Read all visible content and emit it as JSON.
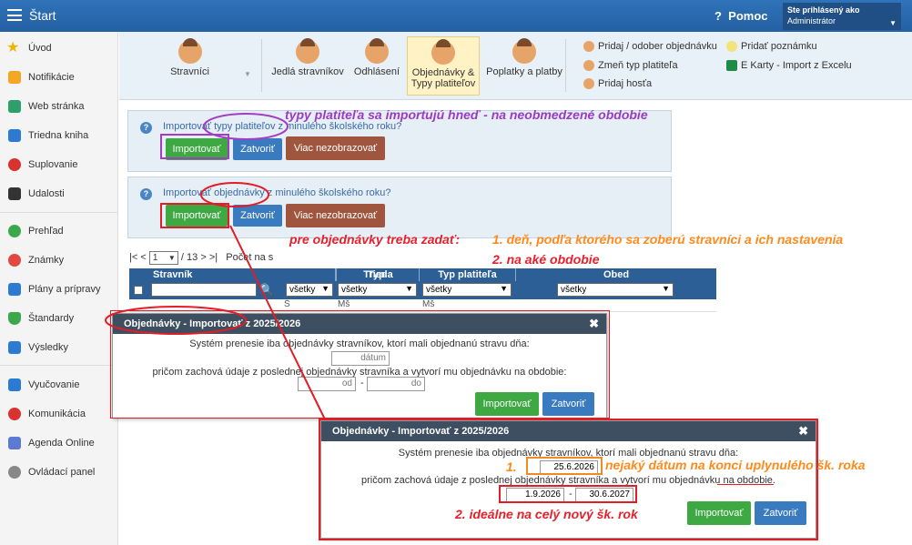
{
  "topbar": {
    "title": "Štart",
    "help_label": "Pomoc",
    "help_icon": "question-icon",
    "user_caption": "Ste prihlásený ako",
    "user_name": "Administrátor"
  },
  "sidebar": {
    "items": [
      {
        "label": "Úvod",
        "icon": "star-icon",
        "color": "#f0b400"
      },
      {
        "label": "Notifikácie",
        "icon": "envelope-icon",
        "color": "#f5a623"
      },
      {
        "label": "Web stránka",
        "icon": "house-icon",
        "color": "#2e9f6b"
      },
      {
        "label": "Triedna kniha",
        "icon": "book-icon",
        "color": "#2a7bd1"
      },
      {
        "label": "Suplovanie",
        "icon": "user-icon",
        "color": "#d9322f"
      },
      {
        "label": "Udalosti",
        "icon": "calendar-icon",
        "color": "#333333"
      },
      {
        "label": "Prehľad",
        "icon": "check-circle-icon",
        "color": "#3ba84a"
      },
      {
        "label": "Známky",
        "icon": "grade-icon",
        "color": "#e4473f"
      },
      {
        "label": "Plány a prípravy",
        "icon": "briefcase-icon",
        "color": "#2a7bd1"
      },
      {
        "label": "Štandardy",
        "icon": "shield-icon",
        "color": "#3ba84a"
      },
      {
        "label": "Výsledky",
        "icon": "bar-chart-icon",
        "color": "#2a7bd1"
      },
      {
        "label": "Vyučovanie",
        "icon": "open-book-icon",
        "color": "#2a7bd1"
      },
      {
        "label": "Komunikácia",
        "icon": "chat-icon",
        "color": "#d9322f"
      },
      {
        "label": "Agenda Online",
        "icon": "feather-icon",
        "color": "#5a7bd1"
      },
      {
        "label": "Ovládací panel",
        "icon": "gear-icon",
        "color": "#888888"
      }
    ]
  },
  "ribbon": {
    "buttons": [
      {
        "label": "Stravníci"
      },
      {
        "label": "Jedlá stravníkov"
      },
      {
        "label": "Odhlásení"
      },
      {
        "label": "Objednávky & Typy platiteľov"
      },
      {
        "label": "Poplatky a platby"
      }
    ],
    "links": [
      {
        "label": "Pridaj / odober objednávku",
        "icon": "person-add-icon"
      },
      {
        "label": "Zmeň typ platiteľa",
        "icon": "person-edit-icon"
      },
      {
        "label": "Pridaj hosťa",
        "icon": "person-guest-icon"
      },
      {
        "label": "Pridať poznámku",
        "icon": "lightbulb-icon"
      },
      {
        "label": "E Karty - Import z Excelu",
        "icon": "excel-icon"
      }
    ]
  },
  "panel1": {
    "question": "Importovať typy platiteľov z minulého školského roku?",
    "import_label": "Importovať",
    "close_label": "Zatvoriť",
    "hide_label": "Viac nezobrazovať"
  },
  "panel2": {
    "question": "Importovať objednávky z minulého školského roku?",
    "import_label": "Importovať",
    "close_label": "Zatvoriť",
    "hide_label": "Viac nezobrazovať"
  },
  "annotations": {
    "a1": "typy platiteľa sa importujú hneď - na neobmedzené obdobie",
    "a2": "pre objednávky treba zadať:",
    "a3": "1. deň, podľa ktorého sa zoberú stravníci a ich nastavenia",
    "a4": "2. na aké obdobie",
    "a5": "nejaký dátum na konci uplynulého šk. roka",
    "a6": "2.  ideálne na celý nový šk. rok",
    "a7": "1."
  },
  "pager": {
    "first": "|<",
    "prev": "<",
    "page": "1",
    "total": "/ 13",
    "next": ">",
    "last": ">|",
    "count_label": "Počet na s"
  },
  "grid": {
    "headers": [
      "Stravník",
      "Typ",
      "Trieda",
      "Typ platiteľa",
      "Obed"
    ],
    "filters": [
      "všetky",
      "všetky",
      "všetky",
      "všetky"
    ],
    "partial_row": [
      "Š",
      "Mš",
      "Mš"
    ]
  },
  "dialog1": {
    "title": "Objednávky - Importovať z 2025/2026",
    "line1": "Systém prenesie iba objednávky stravníkov, ktorí mali objednanú stravu dňa:",
    "date_placeholder": "dátum",
    "line2": "pričom zachová údaje z poslednej objednávky stravníka a vytvorí mu objednávku na obdobie:",
    "from_placeholder": "od",
    "dash": "-",
    "to_placeholder": "do",
    "import_label": "Importovať",
    "close_label": "Zatvoriť"
  },
  "dialog2": {
    "title": "Objednávky - Importovať z 2025/2026",
    "line1": "Systém prenesie iba objednávky stravníkov, ktorí mali objednanú stravu dňa:",
    "date_value": "25.6.2026",
    "line2": "pričom zachová údaje z poslednej objednávky stravníka a vytvorí mu objednávku na obdobie.",
    "from_value": "1.9.2026",
    "dash": "-",
    "to_value": "30.6.2027",
    "import_label": "Importovať",
    "close_label": "Zatvoriť"
  }
}
